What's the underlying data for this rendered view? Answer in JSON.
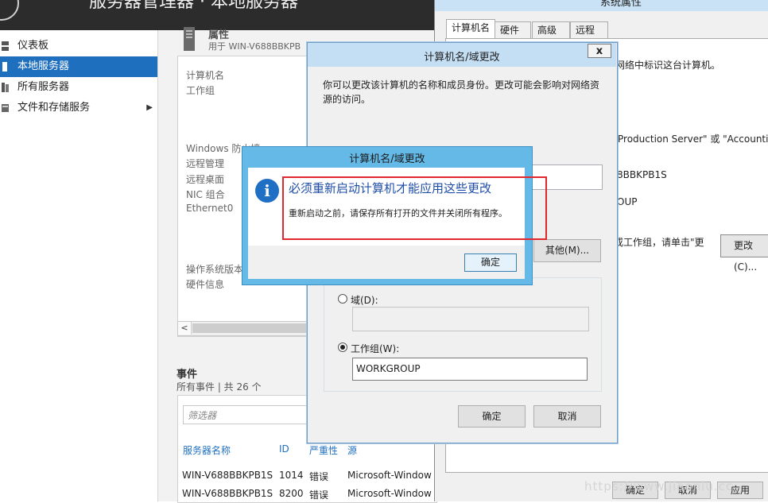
{
  "server_manager": {
    "title": "服务器管理器 · 本地服务器",
    "nav": [
      {
        "label": "仪表板"
      },
      {
        "label": "本地服务器"
      },
      {
        "label": "所有服务器"
      },
      {
        "label": "文件和存储服务"
      }
    ],
    "properties": {
      "title": "属性",
      "subtitle": "用于 WIN-V688BBKPB",
      "labels": [
        "计算机名",
        "工作组",
        "Windows 防火墙",
        "远程管理",
        "远程桌面",
        "NIC 组合",
        "Ethernet0",
        "操作系统版本",
        "硬件信息"
      ]
    },
    "events": {
      "title": "事件",
      "subtitle": "所有事件 | 共 26 个",
      "filter_placeholder": "筛选器",
      "columns": [
        "服务器名称",
        "ID",
        "严重性",
        "源"
      ],
      "rows": [
        [
          "WIN-V688BBKPB1S",
          "1014",
          "错误",
          "Microsoft-Window"
        ],
        [
          "WIN-V688BBKPB1S",
          "8200",
          "错误",
          "Microsoft-Window"
        ]
      ]
    }
  },
  "system_properties": {
    "title": "系统属性",
    "tabs": [
      "计算机名",
      "硬件",
      "高级",
      "远程"
    ],
    "texts": [
      "网络中标识这台计算机。",
      "Production Server\" 或 \"Accounting",
      "8BBKPB1S",
      "OUP",
      "或工作组，请单击\"更"
    ],
    "change_button": "更改(C)...",
    "bottom_buttons": [
      "确定",
      "取消",
      "应用"
    ]
  },
  "name_change_dialog": {
    "title": "计算机名/域更改",
    "close_label": "x",
    "description": "你可以更改该计算机的名称和成员身份。更改可能会影响对网络资源的访问。",
    "more_button": "其他(M)...",
    "domain_label": "域(D):",
    "workgroup_label": "工作组(W):",
    "workgroup_value": "WORKGROUP",
    "ok_button": "确定",
    "cancel_button": "取消"
  },
  "restart_message": {
    "title": "计算机名/域更改",
    "main_text": "必须重新启动计算机才能应用这些更改",
    "detail_text": "重新启动之前，请保存所有打开的文件并关闭所有程序。",
    "ok_button": "确定"
  },
  "watermark": "https://www.jiaoniu.cc"
}
